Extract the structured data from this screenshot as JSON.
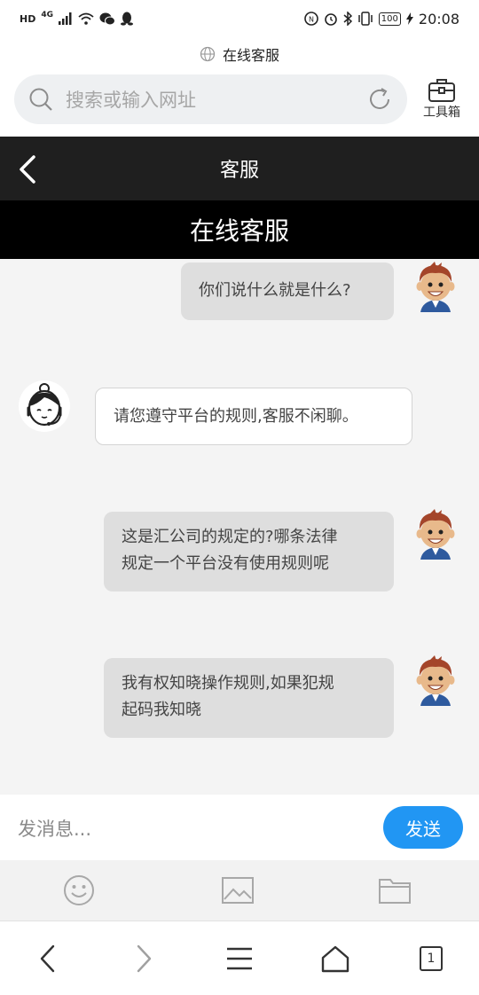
{
  "status_bar": {
    "hd": "HD",
    "network": "4G",
    "battery": "100",
    "time": "20:08",
    "left_icons": [
      "signal-icon",
      "wifi-icon",
      "wechat-icon",
      "qq-icon"
    ],
    "right_icons": [
      "nfc-icon",
      "alarm-icon",
      "bluetooth-icon",
      "vibrate-icon",
      "charging-icon"
    ]
  },
  "browser": {
    "page_title": "在线客服",
    "search_placeholder": "搜索或输入网址",
    "toolbox_label": "工具箱"
  },
  "app_header": {
    "title": "客服"
  },
  "chat": {
    "header_title": "在线客服",
    "messages": [
      {
        "sender": "me",
        "lines": [
          "你们说什么就是什么?"
        ]
      },
      {
        "sender": "service",
        "lines": [
          "请您遵守平台的规则,客服不闲聊。"
        ]
      },
      {
        "sender": "me",
        "lines": [
          "这是汇公司的规定的?哪条法律",
          "规定一个平台没有使用规则呢"
        ]
      },
      {
        "sender": "me",
        "lines": [
          "我有权知晓操作规则,如果犯规",
          "起码我知晓"
        ]
      }
    ]
  },
  "composer": {
    "placeholder": "发消息...",
    "send_label": "发送"
  },
  "tools": [
    "emoji-icon",
    "image-icon",
    "folder-icon"
  ],
  "bottom_nav": {
    "tab_count": "1"
  },
  "colors": {
    "header_bg": "#1f1f1f",
    "chat_header_bg": "#000000",
    "chat_bg": "#f4f4f4",
    "my_bubble": "#dedede",
    "their_bubble": "#ffffff",
    "send_button": "#2196f3"
  }
}
